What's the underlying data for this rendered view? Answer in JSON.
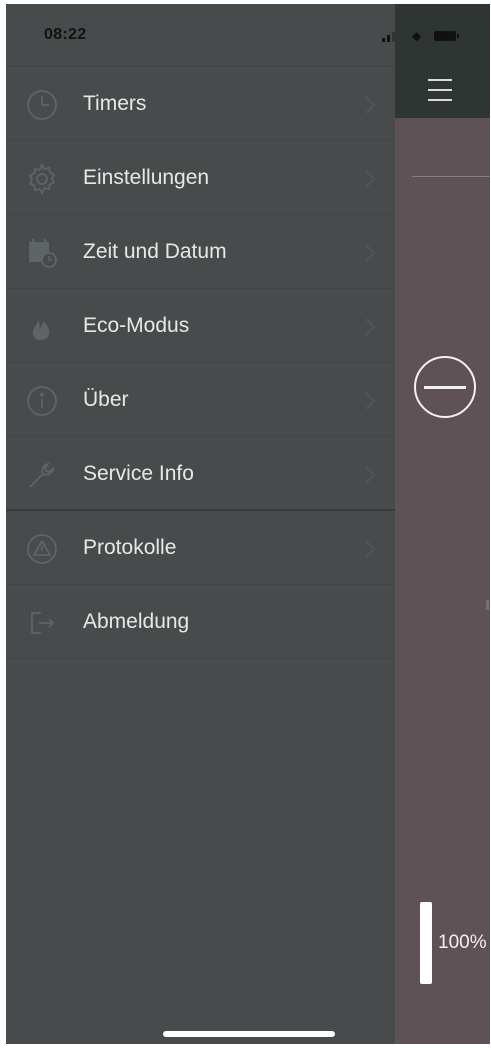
{
  "status_bar": {
    "time": "08:22"
  },
  "menu": {
    "items": [
      {
        "label": "Timers",
        "icon": "clock-icon"
      },
      {
        "label": "Einstellungen",
        "icon": "gear-icon"
      },
      {
        "label": "Zeit und Datum",
        "icon": "calendar-clock-icon"
      },
      {
        "label": "Eco-Modus",
        "icon": "flame-icon"
      },
      {
        "label": "Über",
        "icon": "info-icon"
      },
      {
        "label": "Service Info",
        "icon": "wrench-icon"
      },
      {
        "label": "Protokolle",
        "icon": "warning-icon"
      },
      {
        "label": "Abmeldung",
        "icon": "logout-icon"
      }
    ]
  },
  "main": {
    "level_text": "100%",
    "level_fraction": 1.0
  },
  "colors": {
    "drawer_bg": "#474b4c",
    "main_bg": "#5f5257",
    "topbar_bg": "#2f3532",
    "icon_color": "#5f6465",
    "label_color": "#e8e8e8"
  }
}
